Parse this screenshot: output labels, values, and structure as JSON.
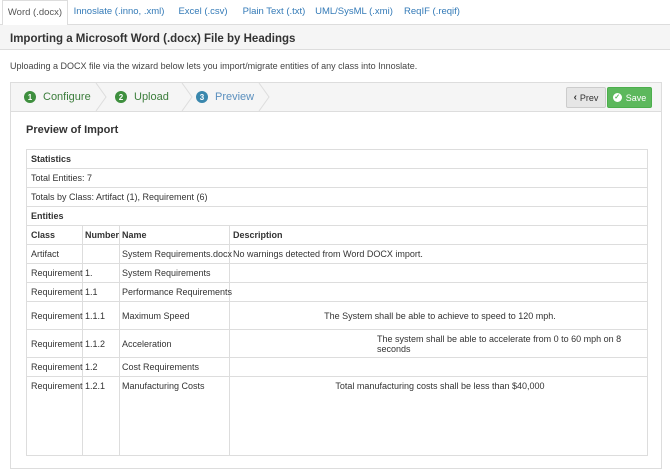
{
  "tabs": [
    {
      "label": "Word (.docx)",
      "active": true
    },
    {
      "label": "Innoslate (.inno, .xml)",
      "active": false
    },
    {
      "label": "Excel (.csv)",
      "active": false
    },
    {
      "label": "Plain Text (.txt)",
      "active": false
    },
    {
      "label": "UML/SysML (.xmi)",
      "active": false
    },
    {
      "label": "ReqIF (.reqif)",
      "active": false
    }
  ],
  "page_title": "Importing a Microsoft Word (.docx) File by Headings",
  "intro": "Uploading a DOCX file via the wizard below lets you import/migrate entities of any class into Innoslate.",
  "wizard": {
    "steps": [
      {
        "num": "1",
        "label": "Configure"
      },
      {
        "num": "2",
        "label": "Upload"
      },
      {
        "num": "3",
        "label": "Preview"
      }
    ],
    "prev_label": "Prev",
    "prev_icon": "chevron-left-icon",
    "save_label": "Save",
    "save_icon": "check-circle-icon",
    "colors": {
      "save": "#5cb85c",
      "step_done": "#3e8f3e",
      "step_active": "#3a87ad"
    }
  },
  "preview_title": "Preview of Import",
  "statistics": {
    "heading": "Statistics",
    "total_entities": "Total Entities: 7",
    "totals_by_class": "Totals by Class: Artifact (1), Requirement (6)"
  },
  "entities": {
    "heading": "Entities",
    "columns": [
      "Class",
      "Number",
      "Name",
      "Description"
    ],
    "rows": [
      {
        "class": "Artifact",
        "number": "",
        "name": "System Requirements.docx",
        "description": "No warnings detected from Word DOCX import."
      },
      {
        "class": "Requirement",
        "number": "1.",
        "name": "System Requirements",
        "description": ""
      },
      {
        "class": "Requirement",
        "number": "1.1",
        "name": "Performance Requirements",
        "description": ""
      },
      {
        "class": "Requirement",
        "number": "1.1.1",
        "name": "Maximum Speed",
        "description": "The System shall be able to achieve to speed to 120 mph."
      },
      {
        "class": "Requirement",
        "number": "1.1.2",
        "name": "Acceleration",
        "description": "The system shall be able to accelerate from 0 to 60 mph on 8 seconds"
      },
      {
        "class": "Requirement",
        "number": "1.2",
        "name": "Cost Requirements",
        "description": ""
      },
      {
        "class": "Requirement",
        "number": "1.2.1",
        "name": "Manufacturing Costs",
        "description": "Total manufacturing costs shall be less than $40,000"
      }
    ]
  }
}
